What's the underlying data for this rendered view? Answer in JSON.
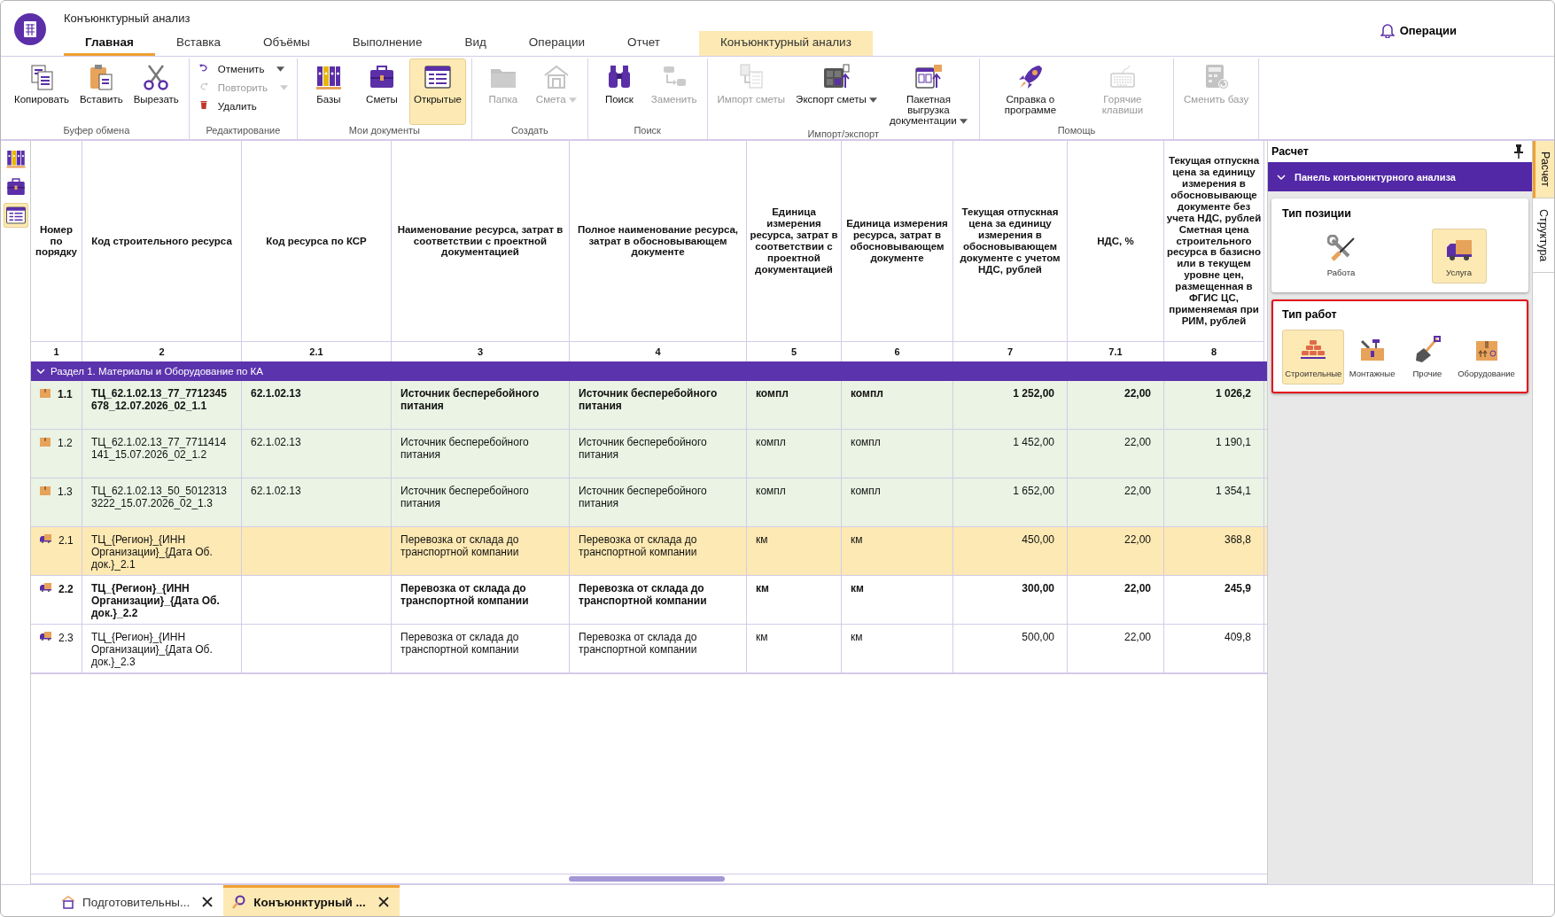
{
  "app": {
    "title": "Конъюнктурный анализ"
  },
  "menu_tabs": [
    {
      "label": "Главная",
      "selected": true,
      "kind": "normal"
    },
    {
      "label": "Вставка",
      "selected": false,
      "kind": "normal"
    },
    {
      "label": "Объёмы",
      "selected": false,
      "kind": "normal"
    },
    {
      "label": "Выполнение",
      "selected": false,
      "kind": "normal"
    },
    {
      "label": "Вид",
      "selected": false,
      "kind": "normal"
    },
    {
      "label": "Операции",
      "selected": false,
      "kind": "normal"
    },
    {
      "label": "Отчет",
      "selected": false,
      "kind": "normal"
    },
    {
      "label": "Конъюнктурный анализ",
      "selected": false,
      "kind": "context"
    }
  ],
  "notifications": {
    "label": "Операции"
  },
  "ribbon_groups": [
    {
      "label": "Буфер обмена",
      "items": [
        {
          "label": "Копировать",
          "kind": "large",
          "disabled": false,
          "selected": false,
          "dropdown": false
        },
        {
          "label": "Вставить",
          "kind": "large",
          "disabled": false,
          "selected": false,
          "dropdown": false
        },
        {
          "label": "Вырезать",
          "kind": "large",
          "disabled": false,
          "selected": false,
          "dropdown": false
        }
      ]
    },
    {
      "label": "Редактирование",
      "items": [
        {
          "label": "Отменить",
          "kind": "small",
          "disabled": false,
          "selected": false,
          "dropdown": true
        },
        {
          "label": "Повторить",
          "kind": "small",
          "disabled": true,
          "selected": false,
          "dropdown": true
        },
        {
          "label": "Удалить",
          "kind": "small",
          "disabled": false,
          "selected": false,
          "dropdown": false
        }
      ]
    },
    {
      "label": "Мои документы",
      "items": [
        {
          "label": "Базы",
          "kind": "large",
          "disabled": false,
          "selected": false,
          "dropdown": false
        },
        {
          "label": "Сметы",
          "kind": "large",
          "disabled": false,
          "selected": false,
          "dropdown": false
        },
        {
          "label": "Открытые",
          "kind": "large",
          "disabled": false,
          "selected": true,
          "dropdown": false
        }
      ]
    },
    {
      "label": "Создать",
      "items": [
        {
          "label": "Папка",
          "kind": "large",
          "disabled": true,
          "selected": false,
          "dropdown": false
        },
        {
          "label": "Смета",
          "kind": "large",
          "disabled": true,
          "selected": false,
          "dropdown": true
        }
      ]
    },
    {
      "label": "Поиск",
      "items": [
        {
          "label": "Поиск",
          "kind": "large",
          "disabled": false,
          "selected": false,
          "dropdown": false
        },
        {
          "label": "Заменить",
          "kind": "large",
          "disabled": true,
          "selected": false,
          "dropdown": false
        }
      ]
    },
    {
      "label": "Импорт/экспорт",
      "items": [
        {
          "label": "Импорт сметы",
          "kind": "large",
          "disabled": true,
          "selected": false,
          "dropdown": false
        },
        {
          "label": "Экспорт сметы",
          "kind": "large",
          "disabled": false,
          "selected": false,
          "dropdown": true
        },
        {
          "label": "Пакетная выгрузка документации",
          "kind": "large",
          "disabled": false,
          "selected": false,
          "dropdown": true
        }
      ]
    },
    {
      "label": "Помощь",
      "items": [
        {
          "label": "Справка о программе",
          "kind": "large",
          "disabled": false,
          "selected": false,
          "dropdown": false
        },
        {
          "label": "Горячие клавиши",
          "kind": "large",
          "disabled": true,
          "selected": false,
          "dropdown": false
        }
      ]
    },
    {
      "items": [
        {
          "label": "Сменить базу",
          "kind": "large",
          "disabled": true,
          "selected": false,
          "dropdown": false
        }
      ]
    }
  ],
  "sidebar": [
    {
      "selected": false
    },
    {
      "selected": false
    },
    {
      "selected": true
    }
  ],
  "table": {
    "columns": [
      {
        "header": "Номер по порядку",
        "number": "1"
      },
      {
        "header": "Код строительного ресурса",
        "number": "2"
      },
      {
        "header": "Код ресурса по КСР",
        "number": "2.1"
      },
      {
        "header": "Наименование ресурса, затрат в соответствии с проектной документацией",
        "number": "3"
      },
      {
        "header": "Полное наименование ресурса, затрат в обосновывающем документе",
        "number": "4"
      },
      {
        "header": "Единица измерения ресурса, затрат в соответствии с проектной документацией",
        "number": "5"
      },
      {
        "header": "Единица измерения ресурса, затрат в обосновывающем документе",
        "number": "6"
      },
      {
        "header": "Текущая отпускная цена за единицу измерения в обосновывающем документе с учетом НДС, рублей",
        "number": "7"
      },
      {
        "header": "НДС, %",
        "number": "7.1"
      },
      {
        "header": "Текущая отпускна\nцена за единицу\nизмерения в\nобосновывающе\nдокументе без\nучета НДС, рублей\nСметная цена\nстроительного\nресурса в базисно\nили в текущем\nуровне цен,\nразмещенная в\nФГИС ЦС,\nприменяемая при\nРИМ, рублей",
        "number": "8"
      }
    ],
    "section": {
      "title": "Раздел 1. Материалы и Оборудование по КА",
      "expanded": true
    },
    "rows": [
      {
        "kind": "material",
        "emphasized": true,
        "selected": false,
        "cells": [
          "1.1",
          "ТЦ_62.1.02.13_77_7712345678_12.07.2026_02_1.1",
          "62.1.02.13",
          "Источник бесперебойного питания",
          "Источник бесперебойного питания",
          "компл",
          "компл",
          "1 252,00",
          "22,00",
          "1 026,2"
        ]
      },
      {
        "kind": "material",
        "emphasized": false,
        "selected": false,
        "cells": [
          "1.2",
          "ТЦ_62.1.02.13_77_7711414141_15.07.2026_02_1.2",
          "62.1.02.13",
          "Источник бесперебойного питания",
          "Источник бесперебойного питания",
          "компл",
          "компл",
          "1 452,00",
          "22,00",
          "1 190,1"
        ]
      },
      {
        "kind": "material",
        "emphasized": false,
        "selected": false,
        "cells": [
          "1.3",
          "ТЦ_62.1.02.13_50_50123133222_15.07.2026_02_1.3",
          "62.1.02.13",
          "Источник бесперебойного питания",
          "Источник бесперебойного питания",
          "компл",
          "компл",
          "1 652,00",
          "22,00",
          "1 354,1"
        ]
      },
      {
        "kind": "transport",
        "emphasized": false,
        "selected": true,
        "cells": [
          "2.1",
          "ТЦ_{Регион}_{ИНН Организации}_{Дата Об. док.}_2.1",
          "",
          "Перевозка от склада до транспортной компании",
          "Перевозка от склада до транспортной компании",
          "км",
          "км",
          "450,00",
          "22,00",
          "368,8"
        ]
      },
      {
        "kind": "transport",
        "emphasized": true,
        "selected": false,
        "cells": [
          "2.2",
          "ТЦ_{Регион}_{ИНН Организации}_{Дата Об. док.}_2.2",
          "",
          "Перевозка от склада до транспортной компании",
          "Перевозка от склада до транспортной компании",
          "км",
          "км",
          "300,00",
          "22,00",
          "245,9"
        ]
      },
      {
        "kind": "transport",
        "emphasized": false,
        "selected": false,
        "cells": [
          "2.3",
          "ТЦ_{Регион}_{ИНН Организации}_{Дата Об. док.}_2.3",
          "",
          "Перевозка от склада до транспортной компании",
          "Перевозка от склада до транспортной компании",
          "км",
          "км",
          "500,00",
          "22,00",
          "409,8"
        ]
      }
    ]
  },
  "panel": {
    "title": "Расчет",
    "section": {
      "title": "Панель конъюнктурного анализа",
      "expanded": true
    },
    "cards": [
      {
        "title": "Тип позиции",
        "highlighted": false,
        "options": [
          {
            "label": "Работа",
            "selected": false,
            "kind": "tools"
          },
          {
            "label": "Услуга",
            "selected": true,
            "kind": "truck"
          }
        ]
      },
      {
        "title": "Тип работ",
        "highlighted": true,
        "options": [
          {
            "label": "Строительные",
            "selected": true,
            "kind": "bricks"
          },
          {
            "label": "Монтажные",
            "selected": false,
            "kind": "toolbox"
          },
          {
            "label": "Прочие",
            "selected": false,
            "kind": "shovel"
          },
          {
            "label": "Оборудование",
            "selected": false,
            "kind": "box"
          }
        ]
      }
    ]
  },
  "side_tabs": [
    {
      "label": "Расчет",
      "selected": true
    },
    {
      "label": "Структура",
      "selected": false
    }
  ],
  "doc_tabs": [
    {
      "label": "Подготовительны...",
      "selected": false,
      "kind": "house"
    },
    {
      "label": "Конъюнктурный ...",
      "selected": true,
      "kind": "search"
    }
  ]
}
